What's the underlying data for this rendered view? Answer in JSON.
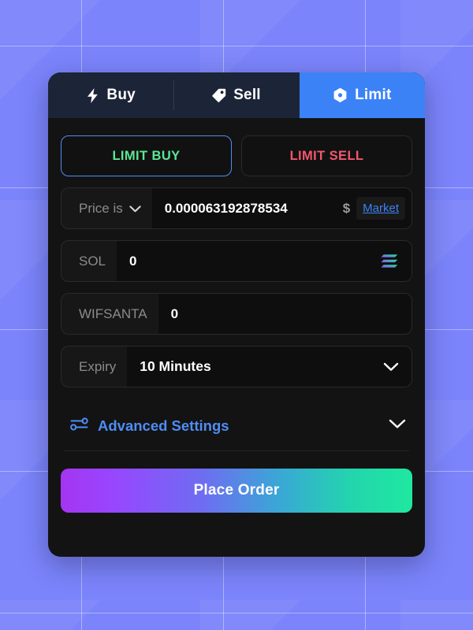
{
  "background": {
    "color": "#7b84fb",
    "grid_color": "#ffffff"
  },
  "card": {
    "background": "#131313"
  },
  "tabs": [
    {
      "label": "Buy",
      "icon": "lightning-bolt-icon",
      "active": false
    },
    {
      "label": "Sell",
      "icon": "price-tag-icon",
      "active": false
    },
    {
      "label": "Limit",
      "icon": "hexagon-gear-icon",
      "active": true,
      "active_color": "#3b82f6"
    }
  ],
  "side": {
    "buy_label": "LIMIT BUY",
    "buy_color": "#5ce694",
    "sell_label": "LIMIT SELL",
    "sell_color": "#f2566f",
    "selected": "LIMIT BUY",
    "selected_border_color": "#4e8df5"
  },
  "fields": {
    "price": {
      "label": "Price is",
      "value": "0.000063192878534",
      "unit": "$",
      "market_label": "Market",
      "market_color": "#3b82f6",
      "dropdown_icon": "chevron-down-icon"
    },
    "pay": {
      "label": "SOL",
      "value": "0",
      "placeholder": "0",
      "icon": "solana-logo-icon"
    },
    "receive": {
      "label": "WIFSANTA",
      "value": "0",
      "placeholder": "0"
    },
    "expiry": {
      "label": "Expiry",
      "value": "10 Minutes",
      "dropdown_icon": "chevron-down-icon"
    }
  },
  "advanced": {
    "label": "Advanced Settings",
    "color": "#4e8df5",
    "icon": "sliders-icon",
    "chevron": "chevron-down-icon"
  },
  "submit": {
    "label": "Place Order",
    "gradient_from": "#9945ff",
    "gradient_to": "#1fe8a0"
  }
}
